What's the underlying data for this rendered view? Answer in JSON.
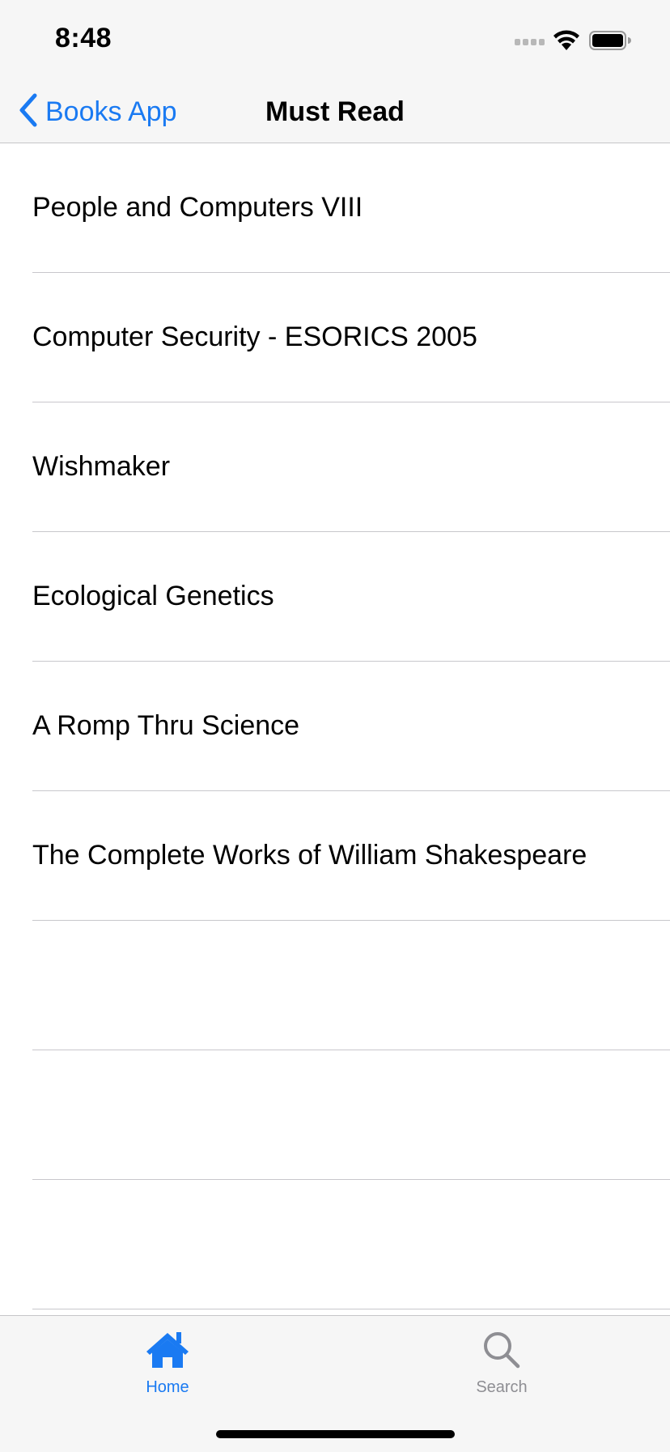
{
  "status_bar": {
    "time": "8:48",
    "icons": [
      "signal-dots-icon",
      "wifi-icon",
      "battery-icon"
    ]
  },
  "nav": {
    "back_label": "Books App",
    "title": "Must Read"
  },
  "books": [
    "People and Computers VIII",
    "Computer Security - ESORICS 2005",
    "Wishmaker",
    "Ecological Genetics",
    "A Romp Thru Science",
    "The Complete Works of William Shakespeare"
  ],
  "tabs": [
    {
      "label": "Home",
      "icon": "home-icon",
      "selected": true
    },
    {
      "label": "Search",
      "icon": "search-icon",
      "selected": false
    }
  ],
  "colors": {
    "accent": "#1a7af2",
    "inactive_tab": "#8e8e93",
    "bar_background": "#f6f6f6",
    "separator": "#c8c7cc"
  }
}
